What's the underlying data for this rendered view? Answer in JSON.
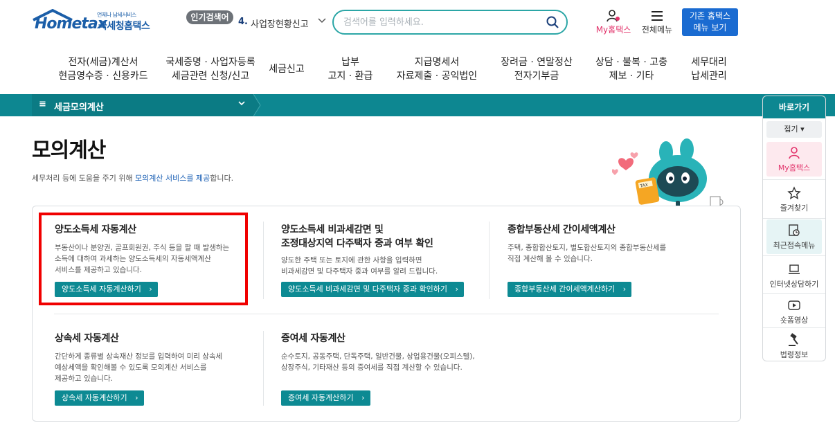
{
  "header": {
    "logo_tag": "언제나 납세서비스",
    "logo_text": "Hometax",
    "logo_sub": "국세청홈택스",
    "popular_label": "인기검색어",
    "popular_rank": "4.",
    "popular_term": "사업장현황신고",
    "search_placeholder": "검색어를 입력하세요.",
    "my_hometax": "My홈택스",
    "all_menu": "전체메뉴",
    "old_hometax_line1": "기존 홈택스",
    "old_hometax_line2": "메뉴 보기"
  },
  "gnb": [
    {
      "line1": "전자(세금)계산서",
      "line2": "현금영수증 · 신용카드"
    },
    {
      "line1": "국세증명 · 사업자등록",
      "line2": "세금관련 신청/신고"
    },
    {
      "line1": "세금신고",
      "line2": ""
    },
    {
      "line1": "납부",
      "line2": "고지 · 환급"
    },
    {
      "line1": "지급명세서",
      "line2": "자료제출 · 공익법인"
    },
    {
      "line1": "장려금 · 연말정산",
      "line2": "전자기부금"
    },
    {
      "line1": "상담 · 불복 · 고충",
      "line2": "제보 · 기타"
    },
    {
      "line1": "세무대리",
      "line2": "납세관리"
    }
  ],
  "lnb": {
    "selected": "세금모의계산"
  },
  "page": {
    "title": "모의계산",
    "desc_pre": "세무처리 등에 도움을 주기 위해 ",
    "desc_hl": "모의계산 서비스를 제공",
    "desc_post": "합니다."
  },
  "cards": [
    {
      "title": "양도소득세 자동계산",
      "desc": [
        "부동산이나 분양권, 골프회원권, 주식 등을 팔 때 발생하는",
        "소득에 대하여 과세하는 양도소득세의 자동세액계산",
        "서비스를 제공하고 있습니다."
      ],
      "button": "양도소득세 자동계산하기"
    },
    {
      "title_line1": "양도소득세 비과세감면 및",
      "title_line2": "조정대상지역 다주택자 중과 여부 확인",
      "desc": [
        "양도한 주택 또는 토지에 관한 사항을 입력하면",
        "비과세감면 및 다주택자 중과 여부를 알려 드립니다."
      ],
      "button": "양도소득세 비과세감면 및 다주택자 중과 확인하기"
    },
    {
      "title": "종합부동산세 간이세액계산",
      "desc": [
        "주택, 종합합산토지, 별도합산토지의 종합부동산세를",
        "직접 계산해 볼 수 있습니다."
      ],
      "button": "종합부동산세 간이세액계산하기"
    },
    {
      "title": "상속세 자동계산",
      "desc": [
        "간단하게 종류별 상속재산 정보를 입력하여 미리 상속세",
        "예상세액을 확인해볼 수 있도록 모의계산 서비스를",
        "제공하고 있습니다."
      ],
      "button": "상속세 자동계산하기"
    },
    {
      "title": "증여세 자동계산",
      "desc": [
        "순수토지, 공동주택, 단독주택, 일반건물, 상업용건물(오피스텔),",
        "상장주식, 기타재산 등의 증여세를 직접 계산할 수 있습니다."
      ],
      "button": "증여세 자동계산하기"
    }
  ],
  "quick": {
    "title": "바로가기",
    "fold": "접기",
    "items": [
      "My홈택스",
      "즐겨찾기",
      "최근접속메뉴",
      "인터넷상담하기",
      "숏폼영상",
      "법령정보"
    ]
  },
  "colors": {
    "teal": "#0d8791",
    "brand_blue": "#1b5ea8",
    "highlight_red": "#f00000",
    "my_pink": "#e2336b"
  }
}
